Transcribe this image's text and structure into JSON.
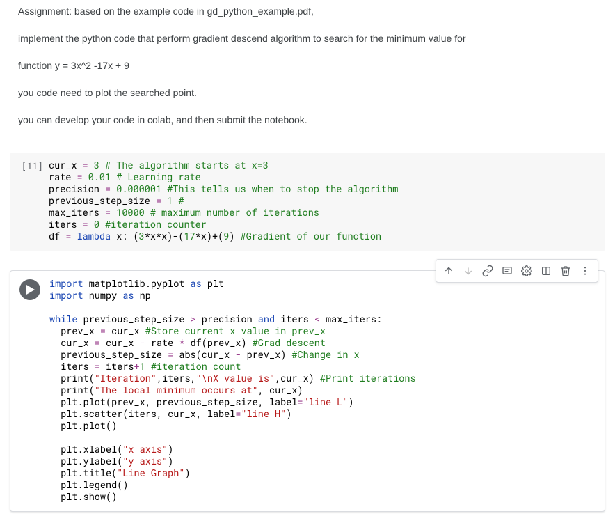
{
  "assignment": {
    "p1": "Assignment: based on the example code in gd_python_example.pdf,",
    "p2": "implement the python code that perform gradient descend algorithm to search for the minimum value for",
    "p3": "function y = 3x^2 -17x + 9",
    "p4": "you code need to plot the searched point.",
    "p5": "you can develop your code in colab, and then submit the notebook."
  },
  "cell1": {
    "prompt": "[11]",
    "code": {
      "l1_a": "cur_x ",
      "l1_eq": "=",
      "l1_b": " ",
      "l1_n": "3",
      "l1_c": " ",
      "l1_com": "# The algorithm starts at x=3",
      "l2_a": "rate ",
      "l2_eq": "=",
      "l2_b": " ",
      "l2_n": "0.01",
      "l2_c": " ",
      "l2_com": "# Learning rate",
      "l3_a": "precision ",
      "l3_eq": "=",
      "l3_b": " ",
      "l3_n": "0.000001",
      "l3_c": " ",
      "l3_com": "#This tells us when to stop the algorithm",
      "l4_a": "previous_step_size ",
      "l4_eq": "=",
      "l4_b": " ",
      "l4_n": "1",
      "l4_c": " ",
      "l4_com": "#",
      "l5_a": "max_iters ",
      "l5_eq": "=",
      "l5_b": " ",
      "l5_n": "10000",
      "l5_c": " ",
      "l5_com": "# maximum number of iterations",
      "l6_a": "iters ",
      "l6_eq": "=",
      "l6_b": " ",
      "l6_n": "0",
      "l6_c": " ",
      "l6_com": "#iteration counter",
      "l7_a": "df ",
      "l7_eq": "=",
      "l7_b": " ",
      "l7_kw": "lambda",
      "l7_c": " x: (",
      "l7_n1": "3",
      "l7_d": "*x*x)-(",
      "l7_n2": "17",
      "l7_e": "*x)+(",
      "l7_n3": "9",
      "l7_f": ") ",
      "l7_com": "#Gradient of our function"
    }
  },
  "cell2": {
    "code": {
      "l1_kw": "import",
      "l1_a": " matplotlib.pyplot ",
      "l1_kw2": "as",
      "l1_b": " plt",
      "l2_kw": "import",
      "l2_a": " numpy ",
      "l2_kw2": "as",
      "l2_b": " np",
      "blank1": "",
      "l3_kw": "while",
      "l3_a": " previous_step_size ",
      "l3_op1": ">",
      "l3_b": " precision ",
      "l3_kw2": "and",
      "l3_c": " iters ",
      "l3_op2": "<",
      "l3_d": " max_iters:",
      "l4_a": "  prev_x ",
      "l4_eq": "=",
      "l4_b": " cur_x ",
      "l4_com": "#Store current x value in prev_x",
      "l5_a": "  cur_x ",
      "l5_eq": "=",
      "l5_b": " cur_x ",
      "l5_op": "-",
      "l5_c": " rate ",
      "l5_op2": "*",
      "l5_d": " df(prev_x) ",
      "l5_com": "#Grad descent",
      "l6_a": "  previous_step_size ",
      "l6_eq": "=",
      "l6_b": " abs(cur_x ",
      "l6_op": "-",
      "l6_c": " prev_x) ",
      "l6_com": "#Change in x",
      "l7_a": "  iters ",
      "l7_eq": "=",
      "l7_b": " iters",
      "l7_op": "+",
      "l7_n": "1",
      "l7_c": " ",
      "l7_com": "#iteration count",
      "l8_a": "  print(",
      "l8_s1": "\"Iteration\"",
      "l8_b": ",iters,",
      "l8_s2": "\"\\nX value is\"",
      "l8_c": ",cur_x) ",
      "l8_com": "#Print iterations",
      "l9_a": "  print(",
      "l9_s": "\"The local minimum occurs at\"",
      "l9_b": ", cur_x)",
      "l10_a": "  plt.plot(prev_x, previous_step_size, label",
      "l10_eq": "=",
      "l10_s": "\"line L\"",
      "l10_b": ")",
      "l11_a": "  plt.scatter(iters, cur_x, label",
      "l11_eq": "=",
      "l11_s": "\"line H\"",
      "l11_b": ")",
      "l12_a": "  plt.plot()",
      "blank2": "",
      "l13_a": "  plt.xlabel(",
      "l13_s": "\"x axis\"",
      "l13_b": ")",
      "l14_a": "  plt.ylabel(",
      "l14_s": "\"y axis\"",
      "l14_b": ")",
      "l15_a": "  plt.title(",
      "l15_s": "\"Line Graph\"",
      "l15_b": ")",
      "l16_a": "  plt.legend()",
      "l17_a": "  plt.show()"
    }
  },
  "toolbar": {
    "up": "Move up",
    "down": "Move down",
    "link": "Link",
    "comment": "Comment",
    "settings": "Settings",
    "mirror": "Mirror",
    "delete": "Delete",
    "more": "More"
  }
}
